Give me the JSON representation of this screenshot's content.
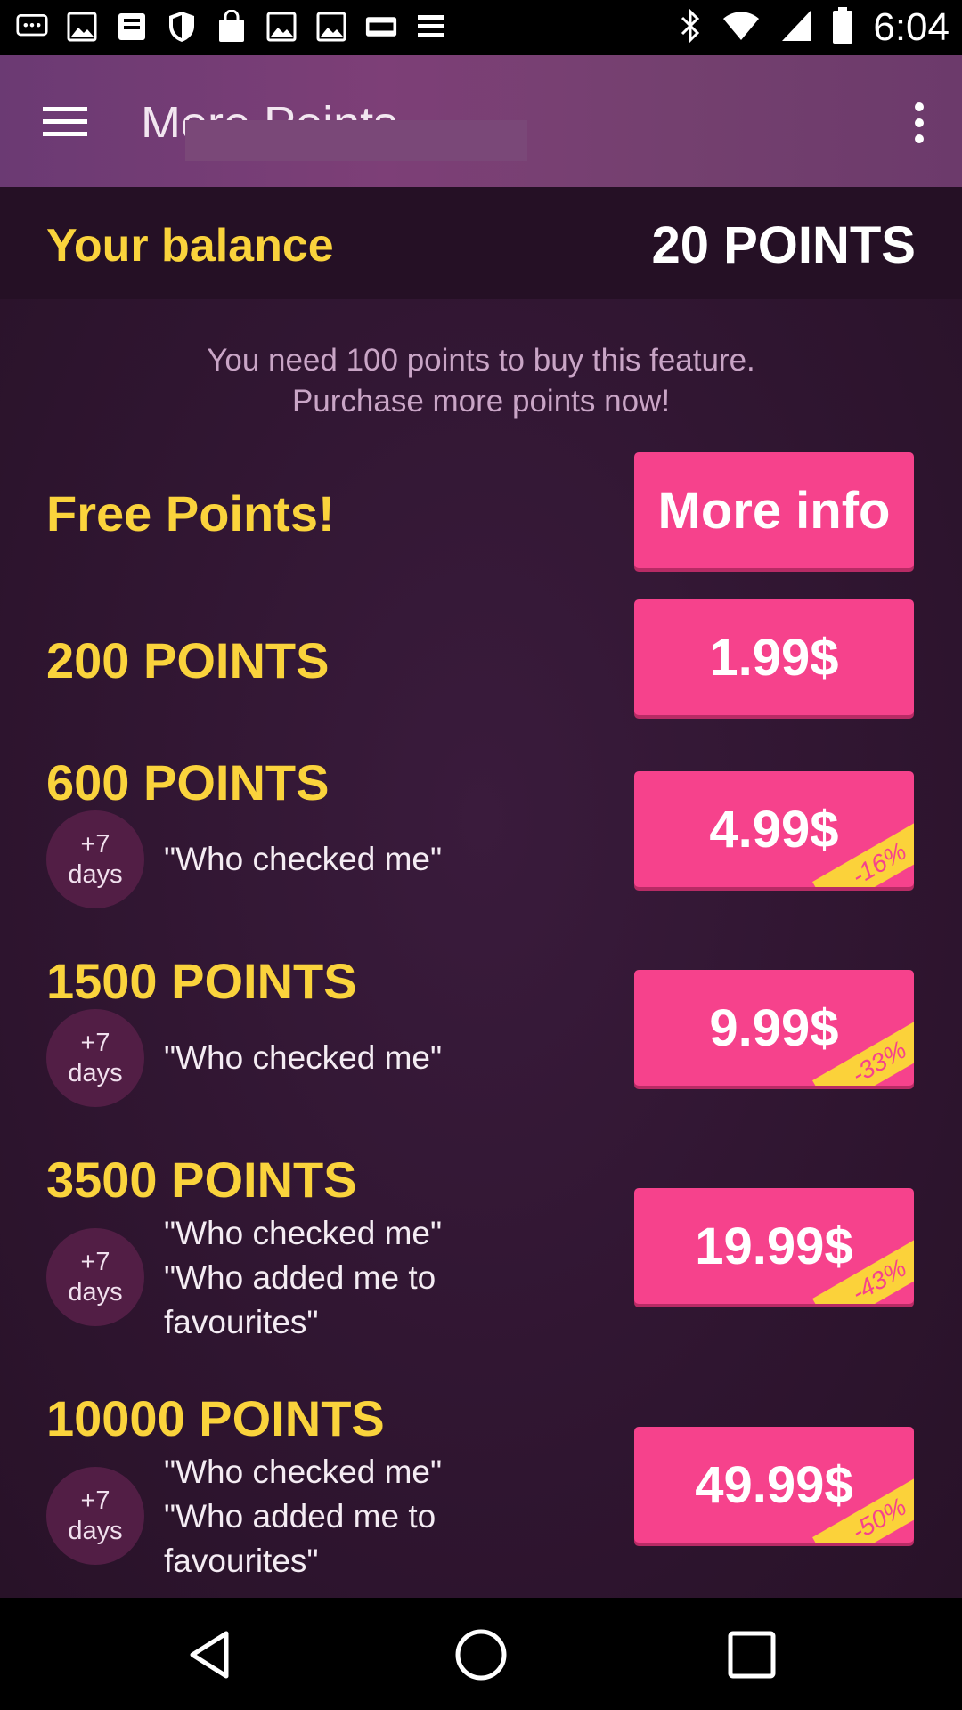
{
  "status_bar": {
    "time": "6:04",
    "left_icons": [
      "message-icon",
      "image-icon",
      "notification-icon",
      "shield-icon",
      "shopping-bag-icon",
      "image-icon",
      "image-icon",
      "dallas-icon",
      "stock-ticker-icon"
    ],
    "right_icons": [
      "bluetooth-icon",
      "wifi-icon",
      "signal-icon",
      "battery-icon"
    ]
  },
  "app_bar": {
    "title": "More Points"
  },
  "balance": {
    "label": "Your balance",
    "value": "20 POINTS"
  },
  "info": {
    "line1": "You need 100 points to buy this feature.",
    "line2": "Purchase more points now!"
  },
  "free_points": {
    "label": "Free Points!",
    "button": "More info"
  },
  "packages": [
    {
      "points": "200 POINTS",
      "price": "1.99$"
    },
    {
      "points": "600 POINTS",
      "price": "4.99$",
      "discount": "-16%",
      "days_plus": "+7",
      "days_label": "days",
      "perks": [
        "\"Who checked me\""
      ]
    },
    {
      "points": "1500 POINTS",
      "price": "9.99$",
      "discount": "-33%",
      "days_plus": "+7",
      "days_label": "days",
      "perks": [
        "\"Who checked me\""
      ]
    },
    {
      "points": "3500 POINTS",
      "price": "19.99$",
      "discount": "-43%",
      "days_plus": "+7",
      "days_label": "days",
      "perks": [
        "\"Who checked me\"",
        "\"Who added me to favourites\""
      ]
    },
    {
      "points": "10000 POINTS",
      "price": "49.99$",
      "discount": "-50%",
      "days_plus": "+7",
      "days_label": "days",
      "perks": [
        "\"Who checked me\"",
        "\"Who added me to favourites\""
      ]
    }
  ],
  "colors": {
    "accent_pink": "#f6428c",
    "accent_yellow": "#fad33c",
    "background": "#2e1630"
  }
}
